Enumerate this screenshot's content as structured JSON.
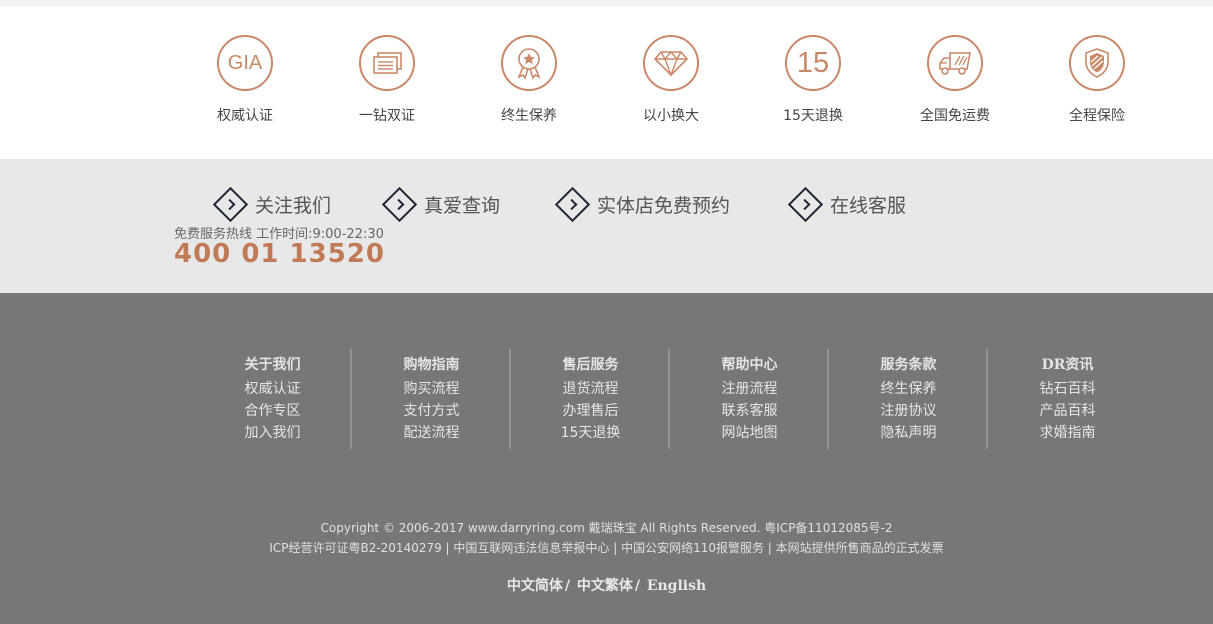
{
  "features": [
    {
      "icon": "gia-icon",
      "badge_text": "GIA",
      "label": "权威认证"
    },
    {
      "icon": "certificate-icon",
      "badge_text": "",
      "label": "一钻双证"
    },
    {
      "icon": "award-medal-icon",
      "badge_text": "",
      "label": "终生保养"
    },
    {
      "icon": "diamond-icon",
      "badge_text": "",
      "label": "以小换大"
    },
    {
      "icon": "fifteen-days-icon",
      "badge_text": "15",
      "label": "15天退换"
    },
    {
      "icon": "delivery-truck-icon",
      "badge_text": "",
      "label": "全国免运费"
    },
    {
      "icon": "shield-icon",
      "badge_text": "",
      "label": "全程保险"
    }
  ],
  "services": [
    {
      "label": "关注我们"
    },
    {
      "label": "真爱查询"
    },
    {
      "label": "实体店免费预约"
    },
    {
      "label": "在线客服"
    }
  ],
  "hotline": {
    "label": "免费服务热线 工作时间:9:00-22:30",
    "number": "400 01 13520"
  },
  "footer_columns": [
    {
      "title": "关于我们",
      "links": [
        "权威认证",
        "合作专区",
        "加入我们"
      ]
    },
    {
      "title": "购物指南",
      "links": [
        "购买流程",
        "支付方式",
        "配送流程"
      ]
    },
    {
      "title": "售后服务",
      "links": [
        "退货流程",
        "办理售后",
        "15天退换"
      ]
    },
    {
      "title": "帮助中心",
      "links": [
        "注册流程",
        "联系客服",
        "网站地图"
      ]
    },
    {
      "title": "服务条款",
      "links": [
        "终生保养",
        "注册协议",
        "隐私声明"
      ]
    },
    {
      "title": "DR资讯",
      "links": [
        "钻石百科",
        "产品百科",
        "求婚指南"
      ]
    }
  ],
  "copyright": "Copyright © 2006-2017 www.darryring.com 戴瑞珠宝 All Rights Reserved. 粤ICP备11012085号-2",
  "icp": "ICP经营许可证粤B2-20140279 | 中国互联网违法信息举报中心 | 中国公安网络110报警服务 | 本网站提供所售商品的正式发票",
  "languages": {
    "simplified": "中文简体",
    "traditional": "中文繁体",
    "english": "English",
    "separator": "/"
  },
  "colors": {
    "accent": "#c98868",
    "hotline": "#c07a58",
    "band_bg": "#e8e8e8",
    "footer_bg": "#777777",
    "diamond_stroke": "#1e2438"
  }
}
